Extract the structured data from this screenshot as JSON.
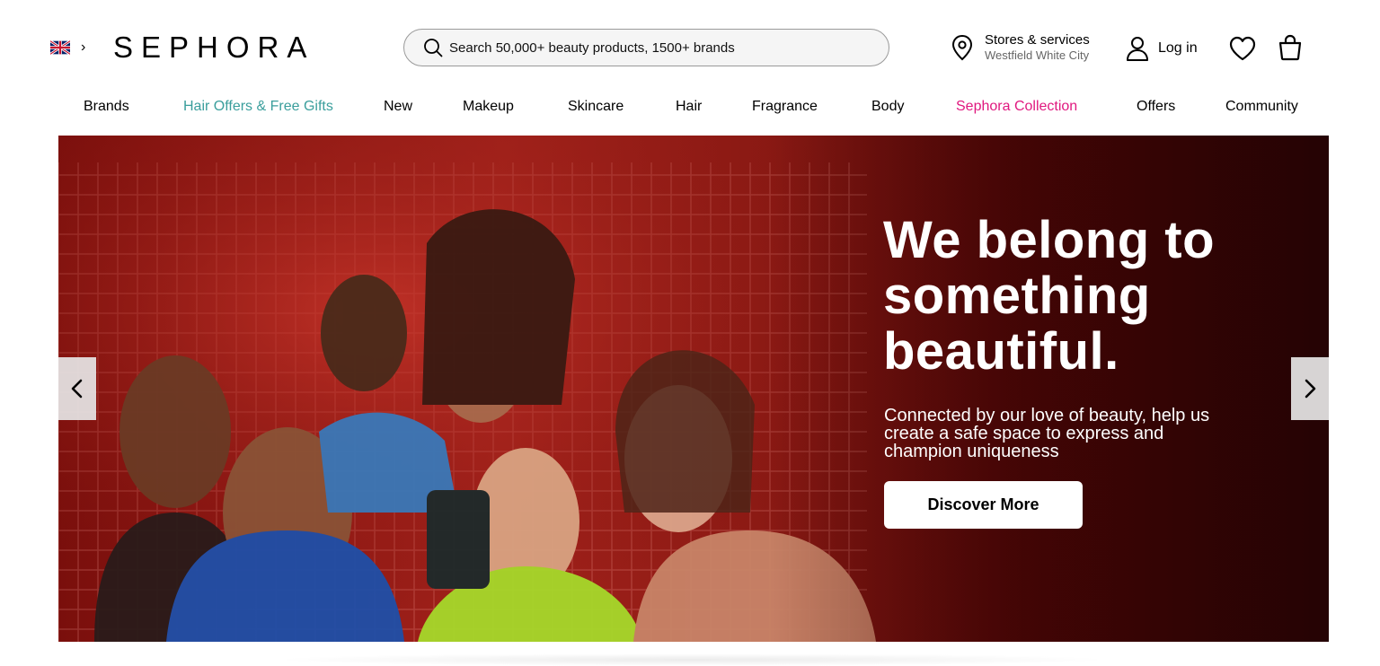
{
  "header": {
    "locale_icon": "uk-flag-icon",
    "logo": "SEPHORA",
    "search": {
      "placeholder": "Search 50,000+ beauty products, 1500+ brands",
      "icon": "search-icon"
    },
    "stores": {
      "title": "Stores & services",
      "subtitle": "Westfield White City",
      "icon": "location-pin-icon"
    },
    "login": {
      "label": "Log in",
      "icon": "user-icon"
    },
    "wishlist_icon": "heart-icon",
    "basket_icon": "shopping-bag-icon"
  },
  "nav": {
    "items": [
      {
        "label": "Brands",
        "color": "#000000"
      },
      {
        "label": "Hair Offers & Free Gifts",
        "color": "#3a9e9c"
      },
      {
        "label": "New",
        "color": "#000000"
      },
      {
        "label": "Makeup",
        "color": "#000000"
      },
      {
        "label": "Skincare",
        "color": "#000000"
      },
      {
        "label": "Hair",
        "color": "#000000"
      },
      {
        "label": "Fragrance",
        "color": "#000000"
      },
      {
        "label": "Body",
        "color": "#000000"
      },
      {
        "label": "Sephora Collection",
        "color": "#e0187f"
      },
      {
        "label": "Offers",
        "color": "#000000"
      },
      {
        "label": "Community",
        "color": "#000000"
      }
    ]
  },
  "hero": {
    "title": "We belong to something beautiful.",
    "subtitle": "Connected by our love of beauty, help us create a safe space to express and champion uniqueness",
    "cta": "Discover More",
    "prev_icon": "chevron-left-icon",
    "next_icon": "chevron-right-icon"
  },
  "colors": {
    "accent_teal": "#3a9e9c",
    "accent_pink": "#e0187f",
    "hero_red": "#a3221b"
  }
}
